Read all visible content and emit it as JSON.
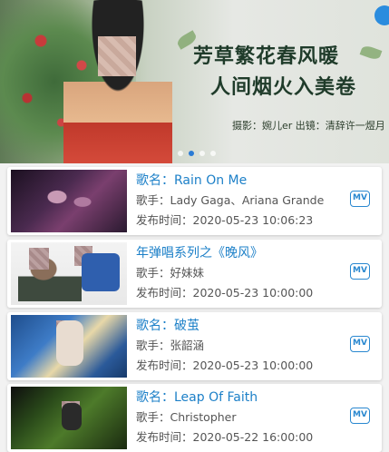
{
  "banner": {
    "title_line1": "芳草繁花春风暖",
    "title_line2": "人间烟火入美卷",
    "credit": "摄影：婉儿er  出镜：清辞许一煜月",
    "dots": 4,
    "active_dot": 1
  },
  "songs": [
    {
      "title": "歌名：Rain On Me",
      "artist": "歌手：Lady Gaga、Ariana Grande",
      "date": "发布时间：2020-05-23 10:06:23",
      "mv_label": "MV"
    },
    {
      "title": "年弹唱系列之《晚风》",
      "artist": "歌手：好妹妹",
      "date": "发布时间：2020-05-23 10:00:00",
      "mv_label": "MV"
    },
    {
      "title": "歌名：破茧",
      "artist": "歌手：张韶涵",
      "date": "发布时间：2020-05-23 10:00:00",
      "mv_label": "MV"
    },
    {
      "title": "歌名：Leap Of Faith",
      "artist": "歌手：Christopher",
      "date": "发布时间：2020-05-22 16:00:00",
      "mv_label": "MV"
    }
  ],
  "colors": {
    "accent": "#1d80c8",
    "active_dot": "#2a7bd5"
  }
}
